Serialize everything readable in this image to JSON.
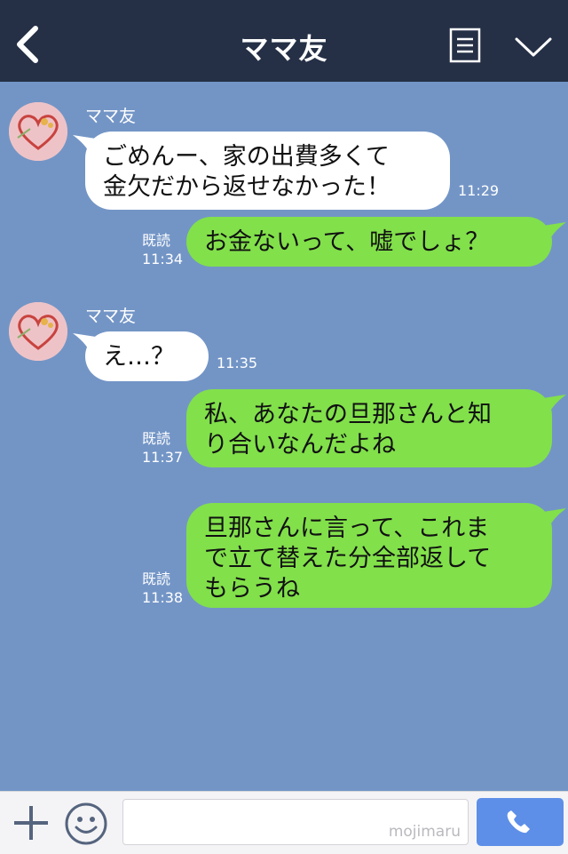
{
  "header": {
    "title": "ママ友"
  },
  "messages": [
    {
      "type": "incoming",
      "sender": "ママ友",
      "text": "ごめんー、家の出費多くて\n金欠だから返せなかった！",
      "time": "11:29"
    },
    {
      "type": "outgoing",
      "read": "既読",
      "text": "お金ないって、嘘でしょ？",
      "time": "11:34"
    },
    {
      "type": "incoming",
      "sender": "ママ友",
      "text": "え…？",
      "time": "11:35"
    },
    {
      "type": "outgoing",
      "read": "既読",
      "text": "私、あなたの旦那さんと知\nり合いなんだよね",
      "time": "11:37"
    },
    {
      "type": "outgoing",
      "read": "既読",
      "text": "旦那さんに言って、これま\nで立て替えた分全部返して\nもらうね",
      "time": "11:38"
    }
  ],
  "footer": {
    "watermark": "mojimaru"
  },
  "colors": {
    "header_bg": "#253046",
    "chat_bg": "#7395c6",
    "incoming_bubble": "#ffffff",
    "outgoing_bubble": "#82e04b",
    "call_button": "#5d8fe8"
  },
  "icons": {
    "back": "chevron-left-icon",
    "menu": "menu-icon",
    "collapse": "chevron-down-icon",
    "add": "plus-icon",
    "emoji": "smiley-icon",
    "call": "phone-icon"
  }
}
